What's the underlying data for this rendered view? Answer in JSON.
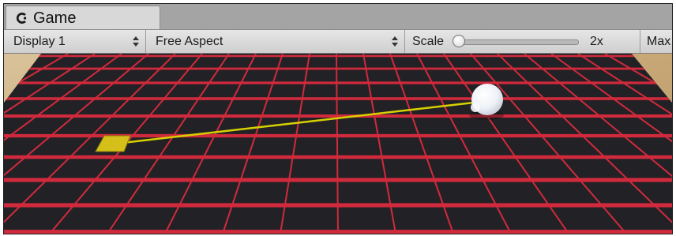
{
  "window": {
    "tab_title": "Game",
    "tab_icon": "unity-game-icon"
  },
  "toolbar": {
    "display_select": {
      "value": "Display 1"
    },
    "aspect_select": {
      "value": "Free Aspect"
    },
    "scale": {
      "label": "Scale",
      "value_text": "2x",
      "slider_fraction": 0.0
    },
    "maximize_button": {
      "label": "Max"
    }
  },
  "scene": {
    "ground_color": "#c9ab7e",
    "floor_color": "#222226",
    "grid_color": "#d12a3c",
    "marker_color": "#d4c019",
    "line_color": "#d8d000",
    "sphere_color": "#f4f6fa"
  }
}
